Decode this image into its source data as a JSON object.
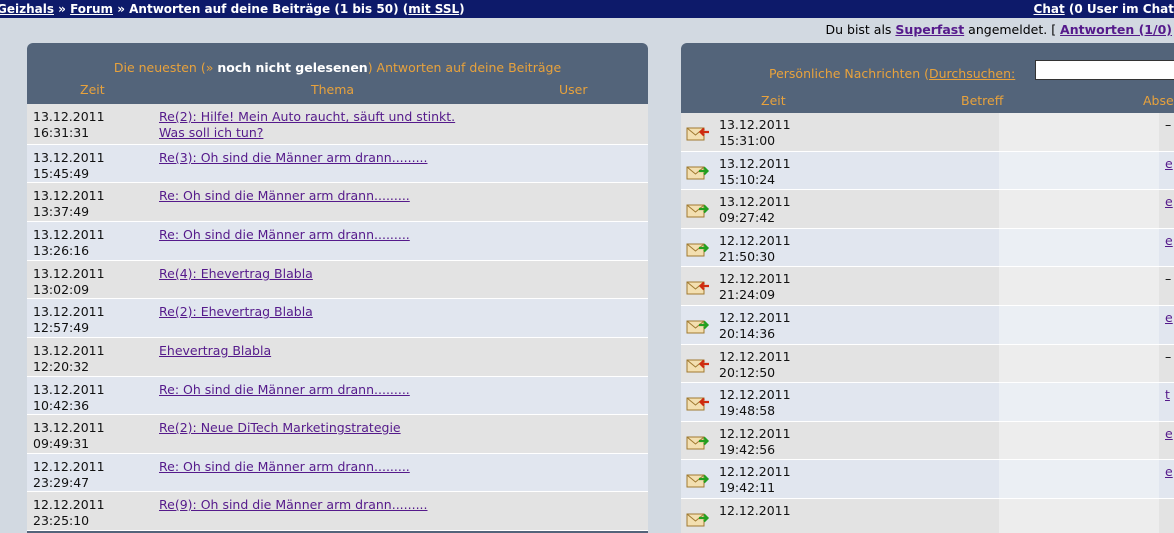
{
  "topbar": {
    "crumb_home": "Geizhals",
    "sep1": " » ",
    "crumb_forum": "Forum",
    "sep2": " » Antworten auf deine Beiträge (1 bis 50) (",
    "ssl_link": "mit SSL",
    "sep3": ")",
    "chat_link": "Chat",
    "chat_status": " (0 User im Chat"
  },
  "login": {
    "prefix": "Du bist als ",
    "username": "Superfast",
    "suffix": " angemeldet. [ ",
    "replies_link": "Antworten (1/0)"
  },
  "left_panel": {
    "title_part1": "Die neuesten (» ",
    "title_bold": "noch nicht gelesenen",
    "title_part2": ") Antworten auf deine Beiträge",
    "col_time": "Zeit",
    "col_topic": "Thema",
    "col_user": "User",
    "rows": [
      {
        "date": "13.12.2011",
        "time": "16:31:31",
        "subject": "Re(2): Hilfe! Mein Auto raucht, säuft und stinkt.",
        "subject2": "Was soll ich tun?"
      },
      {
        "date": "13.12.2011",
        "time": "15:45:49",
        "subject": "Re(3): Oh sind die Männer arm drann.........",
        "subject2": ""
      },
      {
        "date": "13.12.2011",
        "time": "13:37:49",
        "subject": "Re: Oh sind die Männer arm drann.........",
        "subject2": ""
      },
      {
        "date": "13.12.2011",
        "time": "13:26:16",
        "subject": "Re: Oh sind die Männer arm drann.........",
        "subject2": ""
      },
      {
        "date": "13.12.2011",
        "time": "13:02:09",
        "subject": "Re(4): Ehevertrag Blabla",
        "subject2": ""
      },
      {
        "date": "13.12.2011",
        "time": "12:57:49",
        "subject": "Re(2): Ehevertrag Blabla",
        "subject2": ""
      },
      {
        "date": "13.12.2011",
        "time": "12:20:32",
        "subject": "Ehevertrag Blabla",
        "subject2": ""
      },
      {
        "date": "13.12.2011",
        "time": "10:42:36",
        "subject": "Re: Oh sind die Männer arm drann.........",
        "subject2": ""
      },
      {
        "date": "13.12.2011",
        "time": "09:49:31",
        "subject": "Re(2): Neue DiTech Marketingstrategie",
        "subject2": ""
      },
      {
        "date": "12.12.2011",
        "time": "23:29:47",
        "subject": "Re: Oh sind die Männer arm drann.........",
        "subject2": ""
      },
      {
        "date": "12.12.2011",
        "time": "23:25:10",
        "subject": "Re(9): Oh sind die Männer arm drann.........",
        "subject2": ""
      }
    ]
  },
  "right_panel": {
    "title": "Persönliche Nachrichten (",
    "search_link": "Durchsuchen:",
    "col_time": "Zeit",
    "col_subject": "Betreff",
    "col_sender": "Abse",
    "rows": [
      {
        "date": "13.12.2011",
        "time": "15:31:00",
        "icon": "envelope-outgoing-icon",
        "end": "–"
      },
      {
        "date": "13.12.2011",
        "time": "15:10:24",
        "icon": "envelope-incoming-icon",
        "end": "e"
      },
      {
        "date": "13.12.2011",
        "time": "09:27:42",
        "icon": "envelope-incoming-icon",
        "end": "e"
      },
      {
        "date": "12.12.2011",
        "time": "21:50:30",
        "icon": "envelope-incoming-icon",
        "end": "e"
      },
      {
        "date": "12.12.2011",
        "time": "21:24:09",
        "icon": "envelope-outgoing-icon",
        "end": "–"
      },
      {
        "date": "12.12.2011",
        "time": "20:14:36",
        "icon": "envelope-incoming-icon",
        "end": "e"
      },
      {
        "date": "12.12.2011",
        "time": "20:12:50",
        "icon": "envelope-outgoing-icon",
        "end": "–"
      },
      {
        "date": "12.12.2011",
        "time": "19:48:58",
        "icon": "envelope-outgoing-icon",
        "end": "t"
      },
      {
        "date": "12.12.2011",
        "time": "19:42:56",
        "icon": "envelope-incoming-icon",
        "end": "e"
      },
      {
        "date": "12.12.2011",
        "time": "19:42:11",
        "icon": "envelope-incoming-icon",
        "end": "e"
      },
      {
        "date": "12.12.2011",
        "time": "",
        "icon": "envelope-incoming-icon",
        "end": ""
      }
    ]
  },
  "colors": {
    "topbar_bg": "#0d1a6a",
    "panel_header_bg": "#53647a",
    "header_text": "#e8a23c",
    "link": "#551a8b",
    "row_odd": "#e3e3e3",
    "row_even": "#e1e6ef"
  }
}
